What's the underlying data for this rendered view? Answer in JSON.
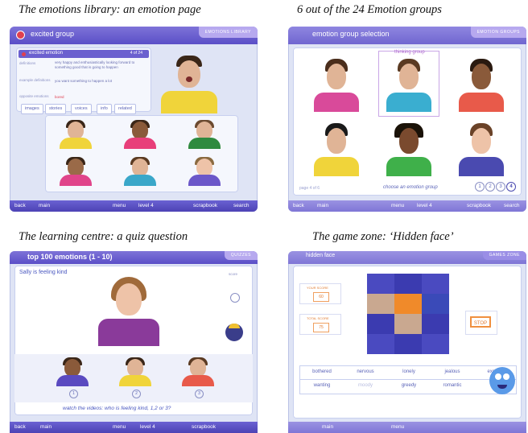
{
  "captions": {
    "tl": "The emotions library: an emotion page",
    "tr": "6 out of the 24 Emotion groups",
    "bl": "The learning centre: a quiz question",
    "br": "The game zone: ‘Hidden face’"
  },
  "library": {
    "title": "excited group",
    "tag": "EMOTIONS LIBRARY",
    "emotion": "excited emotion",
    "pager": "4 of 24",
    "definitions_label": "definitions",
    "definitions_text": "very happy and enthusiastically looking forward to something good that is going to happen",
    "example_label": "example definitions",
    "example_text": "you want something to happen a lot",
    "opposite_label": "opposite emotions",
    "opposite_text": "bored",
    "tabs": [
      "images",
      "stories",
      "voices",
      "info",
      "related"
    ],
    "bottom": [
      "back",
      "main",
      "menu",
      "level 4",
      "scrapbook",
      "search"
    ]
  },
  "groups": {
    "title": "emotion group selection",
    "tag": "EMOTION GROUPS",
    "selected": "thinking group",
    "page": "page 4 of 6",
    "prompt": "choose an emotion group",
    "pages": [
      "1",
      "2",
      "3",
      "4"
    ],
    "bottom": [
      "back",
      "main",
      "menu",
      "level 4",
      "scrapbook",
      "search"
    ]
  },
  "quiz": {
    "title": "top 100 emotions (1 - 10)",
    "tag": "QUIZZES",
    "question": "Sally is feeling kind",
    "score_label": "score",
    "choices": [
      "1",
      "2",
      "3"
    ],
    "instruction": "watch the videos: who is feeling kind, 1,2 or 3?",
    "bottom": [
      "back",
      "main",
      "menu",
      "level 4",
      "scrapbook"
    ]
  },
  "game": {
    "title": "hidden face",
    "tag": "GAMES ZONE",
    "your_score_label": "YOUR SCORE",
    "your_score": "60",
    "total_score_label": "TOTAL SCORE",
    "total_score": "75",
    "stop": "STOP",
    "words": [
      "bothered",
      "nervous",
      "lonely",
      "jealous",
      "excited",
      "wanting",
      "moody",
      "greedy",
      "romantic",
      "shy"
    ],
    "bottom": [
      "main",
      "menu"
    ]
  }
}
